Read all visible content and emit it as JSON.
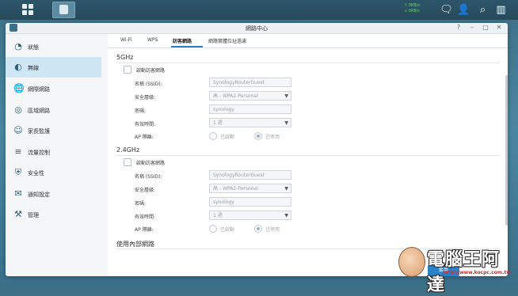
{
  "taskbar": {
    "upload_speed": "↑ 0KB/s",
    "download_speed": "↓ 0KB/s",
    "icons": [
      "main-menu-icon",
      "chat-icon",
      "user-icon",
      "search-icon",
      "widgets-icon"
    ]
  },
  "window": {
    "title": "網路中心",
    "controls": [
      "?",
      "–",
      "□",
      "✕"
    ]
  },
  "sidebar": {
    "items": [
      {
        "label": "狀態",
        "icon": "status-icon"
      },
      {
        "label": "無線",
        "icon": "wifi-icon",
        "active": true
      },
      {
        "label": "網際網路",
        "icon": "internet-icon"
      },
      {
        "label": "區域網路",
        "icon": "lan-icon"
      },
      {
        "label": "家長監護",
        "icon": "parental-icon"
      },
      {
        "label": "流量控制",
        "icon": "traffic-icon"
      },
      {
        "label": "安全性",
        "icon": "security-icon"
      },
      {
        "label": "通知設定",
        "icon": "notification-icon"
      },
      {
        "label": "管理",
        "icon": "tools-icon"
      }
    ]
  },
  "tabs": [
    "Wi-Fi",
    "WPS",
    "訪客網路",
    "網路實體位址過濾"
  ],
  "active_tab": "訪客網路",
  "band_5g": {
    "heading": "5GHz",
    "enable_label": "啟動訪客網路",
    "ssid_label": "名稱 (SSID):",
    "ssid_value": "SynologyRouterGuest",
    "security_label": "安全層級:",
    "security_value": "高 - WPA2-Personal",
    "password_label": "密碼:",
    "password_value": "synology",
    "period_label": "有效時間:",
    "period_value": "1 週",
    "ap_label": "AP 隔離:",
    "ap_on": "已啟動",
    "ap_off": "已停用"
  },
  "band_24g": {
    "heading": "2.4GHz",
    "enable_label": "啟動訪客網路",
    "ssid_label": "名稱 (SSID):",
    "ssid_value": "SynologyRouterGuest",
    "security_label": "安全層級:",
    "security_value": "高 - WPA2-Personal",
    "password_label": "密碼:",
    "password_value": "synology",
    "period_label": "有效時間:",
    "period_value": "1 週",
    "ap_label": "AP 隔離:",
    "ap_on": "已啟動",
    "ap_off": "已停用"
  },
  "internal": {
    "heading": "使用內部網路"
  },
  "apply_button": "套用",
  "watermark": {
    "text": "電腦王阿達",
    "url": "http://www.kocpc.com.tw"
  },
  "colors": {
    "accent": "#2c82c9",
    "active_sidebar": "#cfe6f4",
    "taskbar": "#2d5569"
  }
}
